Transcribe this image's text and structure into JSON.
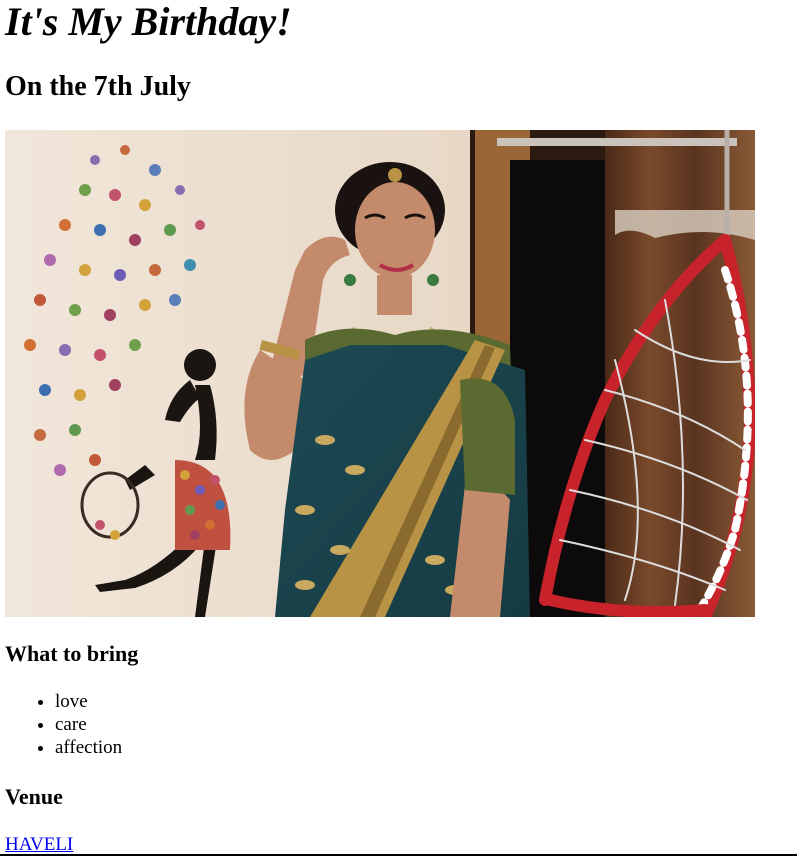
{
  "heading": {
    "title": "It's My Birthday!",
    "date": "On the 7th July"
  },
  "photo": {
    "alt": "Birthday photo"
  },
  "bring": {
    "title": "What to bring",
    "items": [
      "love",
      "care",
      "affection"
    ]
  },
  "venue": {
    "title": "Venue",
    "link_text": "HAVELI"
  },
  "colors": {
    "link": "#0000ee",
    "saree": "#1f4b55",
    "gold_border": "#b89345",
    "wall": "#efe3d6",
    "swing_red": "#c8232b"
  }
}
